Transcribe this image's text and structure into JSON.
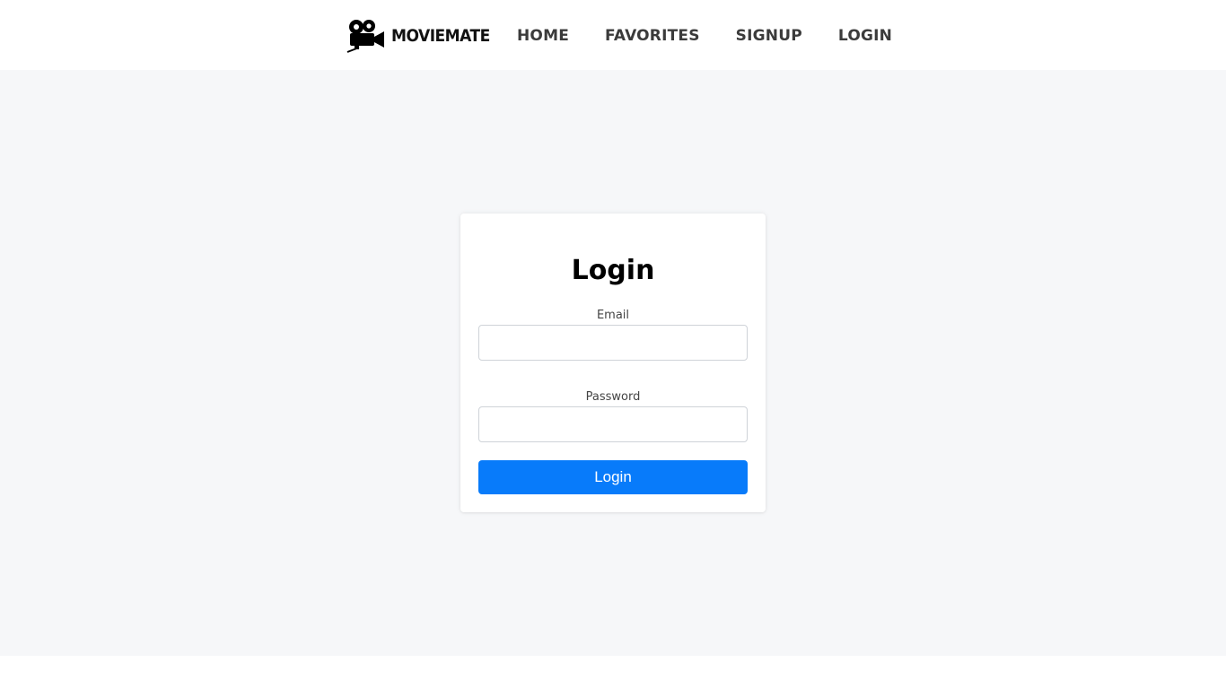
{
  "brand": {
    "name": "MOVIEMATE",
    "icon": "movie-camera-icon"
  },
  "nav": {
    "items": [
      {
        "label": "HOME"
      },
      {
        "label": "FAVORITES"
      },
      {
        "label": "SIGNUP"
      },
      {
        "label": "LOGIN"
      }
    ]
  },
  "login": {
    "title": "Login",
    "email_label": "Email",
    "email_value": "",
    "password_label": "Password",
    "password_value": "",
    "button_label": "Login"
  },
  "colors": {
    "accent": "#087bfa",
    "page_background": "#f6f7f9",
    "nav_text": "#3b3b3b"
  }
}
